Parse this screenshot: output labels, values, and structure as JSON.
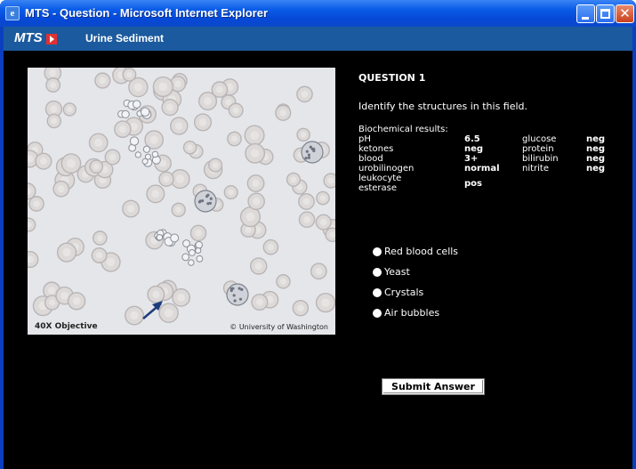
{
  "window": {
    "title": "MTS - Question - Microsoft Internet Explorer",
    "icon": "ie-icon",
    "controls": [
      "minimize-icon",
      "maximize-icon",
      "close-icon"
    ]
  },
  "appbar": {
    "logo": "MTS",
    "module": "Urine Sediment"
  },
  "image": {
    "objective": "40X Objective",
    "credit": "© University of Washington"
  },
  "question": {
    "title": "QUESTION 1",
    "prompt": "Identify the structures in this field.",
    "bio_heading": "Biochemical results:",
    "results_left": [
      {
        "label": "pH",
        "value": "6.5"
      },
      {
        "label": "ketones",
        "value": "neg"
      },
      {
        "label": "blood",
        "value": "3+"
      },
      {
        "label": "urobilinogen",
        "value": "normal"
      },
      {
        "label": "leukocyte esterase",
        "label_lines": [
          "leukocyte",
          "esterase"
        ],
        "value": "pos"
      }
    ],
    "results_right": [
      {
        "label": "glucose",
        "value": "neg"
      },
      {
        "label": "protein",
        "value": "neg"
      },
      {
        "label": "bilirubin",
        "value": "neg"
      },
      {
        "label": "nitrite",
        "value": "neg"
      }
    ],
    "options": [
      "Red blood cells",
      "Yeast",
      "Crystals",
      "Air bubbles"
    ],
    "submit_label": "Submit Answer"
  },
  "colors": {
    "titlebar": "#0a5ce8",
    "appbar": "#1b5a9e",
    "content_bg": "#000000",
    "logo_accent": "#e23030"
  }
}
